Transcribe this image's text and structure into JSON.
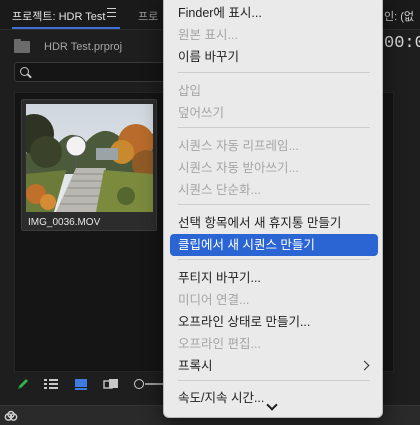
{
  "panel": {
    "tab_title": "프로젝트: HDR Test",
    "tab_second": "프로",
    "right_label": "인: (없",
    "right_timecode": "00:00",
    "path": "HDR Test.prproj",
    "search": {
      "placeholder": "",
      "value": ""
    }
  },
  "clip": {
    "name": "IMG_0036.MOV"
  },
  "colors": {
    "accent": "#2a65d3",
    "tab_underline": "#3d6fd6",
    "pencil": "#35b04a",
    "menu_bg": "#ebeaea"
  },
  "icons": {
    "bin": "folder-bin-icon",
    "search": "search-icon",
    "pencil": "pencil-icon",
    "list_view": "list-view-icon",
    "icon_view": "icon-view-icon",
    "freeform": "freeform-view-icon",
    "creative_cloud": "creative-cloud-icon"
  },
  "context_menu": {
    "items": [
      {
        "label": "Finder에 표시...",
        "enabled": true
      },
      {
        "label": "원본 표시...",
        "enabled": false
      },
      {
        "label": "이름 바꾸기",
        "enabled": true
      },
      {
        "label": "삽입",
        "enabled": false
      },
      {
        "label": "덮어쓰기",
        "enabled": false
      },
      {
        "label": "시퀀스 자동 리프레임...",
        "enabled": false
      },
      {
        "label": "시퀀스 자동 받아쓰기...",
        "enabled": false
      },
      {
        "label": "시퀀스 단순화...",
        "enabled": false
      },
      {
        "label": "선택 항목에서 새 휴지통 만들기",
        "enabled": true
      },
      {
        "label": "클립에서 새 시퀀스 만들기",
        "enabled": true,
        "highlighted": true
      },
      {
        "label": "푸티지 바꾸기...",
        "enabled": true
      },
      {
        "label": "미디어 연결...",
        "enabled": false
      },
      {
        "label": "오프라인 상태로 만들기...",
        "enabled": true
      },
      {
        "label": "오프라인 편집...",
        "enabled": false
      },
      {
        "label": "프록시",
        "enabled": true,
        "submenu": true
      },
      {
        "label": "속도/지속 시간...",
        "enabled": true
      }
    ]
  }
}
